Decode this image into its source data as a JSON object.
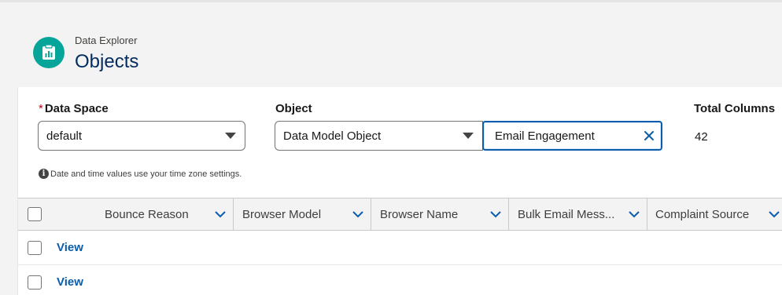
{
  "header": {
    "eyebrow": "Data Explorer",
    "title": "Objects",
    "icon": "report-icon",
    "icon_color": "#06a59a"
  },
  "filters": {
    "data_space": {
      "label": "Data Space",
      "required_marker": "*",
      "value": "default"
    },
    "object": {
      "label": "Object",
      "type_value": "Data Model Object",
      "search_value": "Email Engagement"
    },
    "total_columns": {
      "label": "Total Columns",
      "value": "42"
    }
  },
  "note": "Date and time values use your time zone settings.",
  "table": {
    "columns": [
      "Bounce Reason",
      "Browser Model",
      "Browser Name",
      "Bulk Email Mess...",
      "Complaint Source"
    ],
    "rows": [
      {
        "action": "View"
      },
      {
        "action": "View"
      }
    ]
  },
  "colors": {
    "link": "#0b5cab",
    "title": "#032d60",
    "required": "#ba0517"
  }
}
